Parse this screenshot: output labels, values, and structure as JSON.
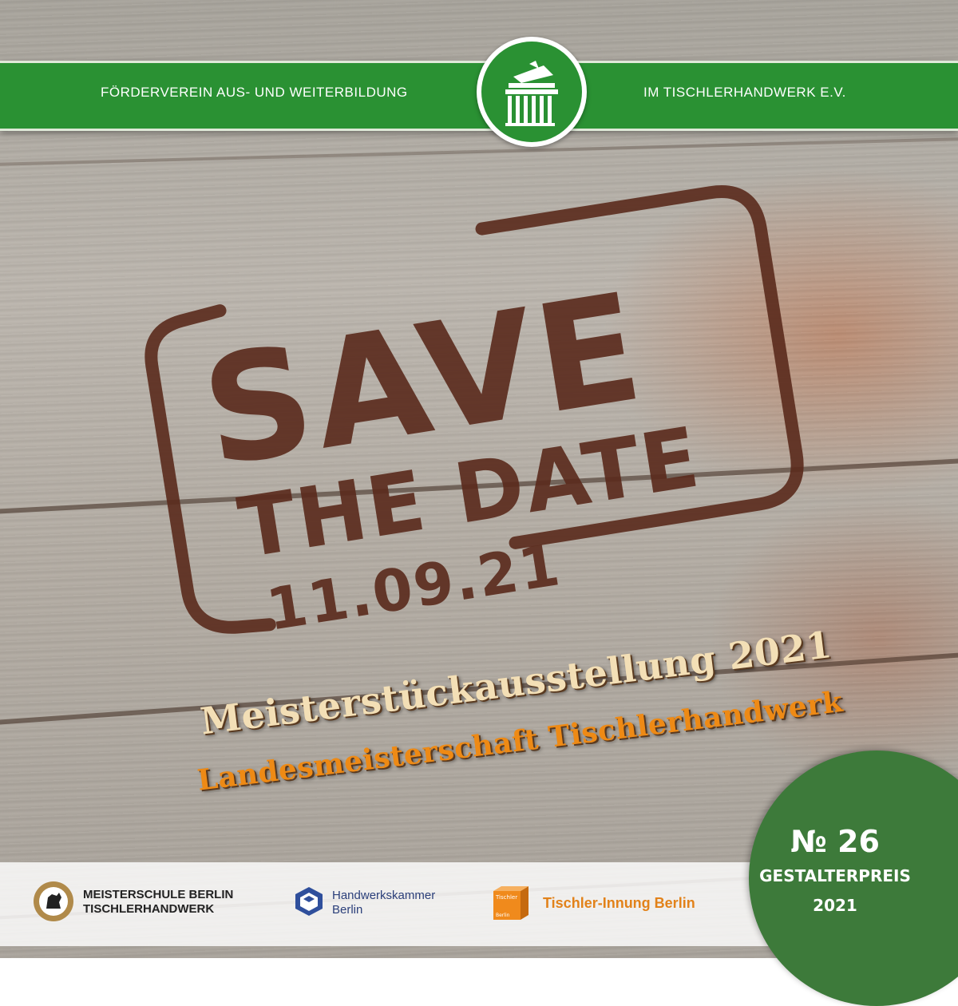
{
  "header": {
    "left_text": "FÖRDERVEREIN AUS- UND WEITERBILDUNG",
    "right_text": "IM TISCHLERHANDWERK E.V.",
    "seal_icon": "brandenburg-gate-plane-icon",
    "ribbon_color": "#2a9133"
  },
  "stamp": {
    "line1": "SAVE",
    "line2": "THE DATE",
    "date": "11.09.21",
    "color": "#5a2a1c"
  },
  "event": {
    "title": "Meisterstückausstellung 2021",
    "subtitle": "Landesmeisterschaft Tischlerhandwerk",
    "title_color": "#f3dfb6",
    "subtitle_color": "#ee8a15"
  },
  "badge": {
    "number": "№ 26",
    "label": "GESTALTERPREIS",
    "year": "2021",
    "color": "#3d7a3a"
  },
  "sponsors": [
    {
      "name_line1": "MEISTERSCHULE BERLIN",
      "name_line2": "TISCHLERHANDWERK",
      "icon": "berlin-bear-gear-icon"
    },
    {
      "name_line1": "Handwerkskammer",
      "name_line2": "Berlin",
      "icon": "hwk-cube-icon"
    },
    {
      "name": "Tischler-Innung Berlin",
      "icon": "tischler-cube-icon",
      "icon_text_top": "Tischler",
      "icon_text_bottom": "Berlin"
    }
  ]
}
